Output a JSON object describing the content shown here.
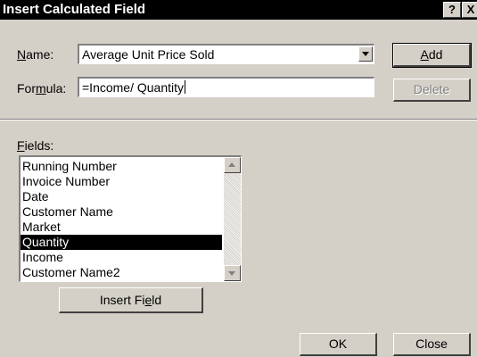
{
  "window": {
    "title": "Insert Calculated Field",
    "help_label": "?",
    "close_label": "X"
  },
  "name_field": {
    "label_pre": "",
    "label_key": "N",
    "label_post": "ame:",
    "value": "Average Unit Price Sold"
  },
  "formula_field": {
    "label_pre": "For",
    "label_key": "m",
    "label_post": "ula:",
    "value": "=Income/ Quantity"
  },
  "buttons": {
    "add_pre": "",
    "add_key": "A",
    "add_post": "dd",
    "delete_label": "Delete",
    "insert_field_pre": "Insert Fi",
    "insert_field_key": "e",
    "insert_field_post": "ld",
    "ok_label": "OK",
    "close_label": "Close"
  },
  "fields_list": {
    "label_pre": "",
    "label_key": "F",
    "label_post": "ields:",
    "items": [
      "Running Number",
      "Invoice Number",
      "Date",
      "Customer Name",
      "Market",
      "Quantity",
      "Income",
      "Customer Name2"
    ],
    "selected": "Quantity"
  }
}
